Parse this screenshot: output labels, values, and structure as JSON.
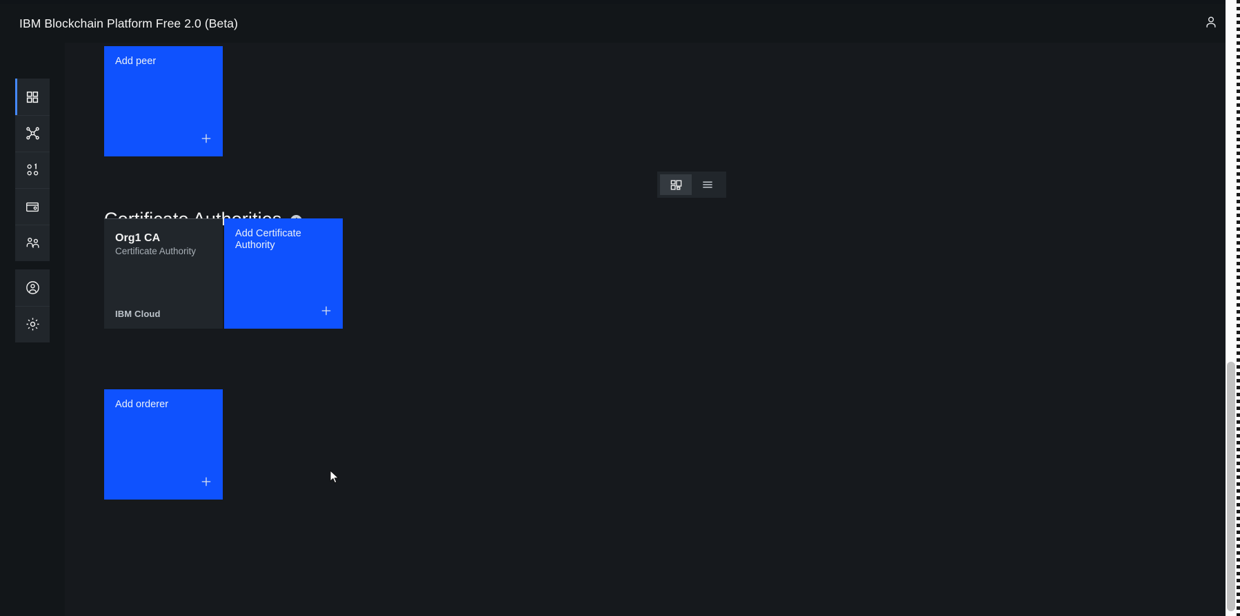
{
  "header": {
    "title": "IBM Blockchain Platform Free 2.0 (Beta)",
    "user_icon": "user-avatar-icon"
  },
  "sidebar": {
    "items": [
      {
        "icon": "dashboard-grid-icon",
        "label": "Dashboard",
        "active": true
      },
      {
        "icon": "network-nodes-icon",
        "label": "Nodes",
        "active": false
      },
      {
        "icon": "channels-binary-icon",
        "label": "Channels",
        "active": false
      },
      {
        "icon": "wallet-icon",
        "label": "Wallet",
        "active": false
      },
      {
        "icon": "organizations-users-icon",
        "label": "Organizations",
        "active": false
      },
      {
        "icon": "user-profile-icon",
        "label": "Profile",
        "active": false
      },
      {
        "icon": "gear-settings-icon",
        "label": "Settings",
        "active": false
      }
    ]
  },
  "main": {
    "add_peer_tile": {
      "title": "Add peer",
      "plus_icon": "plus-icon"
    },
    "certificate_authorities": {
      "heading": "Certificate Authorities",
      "info_icon": "info-icon",
      "info_glyph": "i",
      "view_toggle": {
        "grid": {
          "icon": "grid-view-icon",
          "active": true
        },
        "list": {
          "icon": "list-view-icon",
          "active": false
        }
      },
      "cards": [
        {
          "name": "Org1 CA",
          "type": "Certificate Authority",
          "location": "IBM Cloud"
        }
      ],
      "add_tile": {
        "title": "Add Certificate Authority",
        "plus_icon": "plus-icon"
      }
    },
    "add_orderer_tile": {
      "title": "Add orderer",
      "plus_icon": "plus-icon"
    }
  },
  "colors": {
    "accent_blue": "#0f52fe",
    "active_indicator": "#4589ff",
    "background": "#16191d",
    "panel": "#121619",
    "tile_dark": "#21262b"
  },
  "scrollbar": {
    "thumb_label": "vertical-scroll-thumb"
  }
}
